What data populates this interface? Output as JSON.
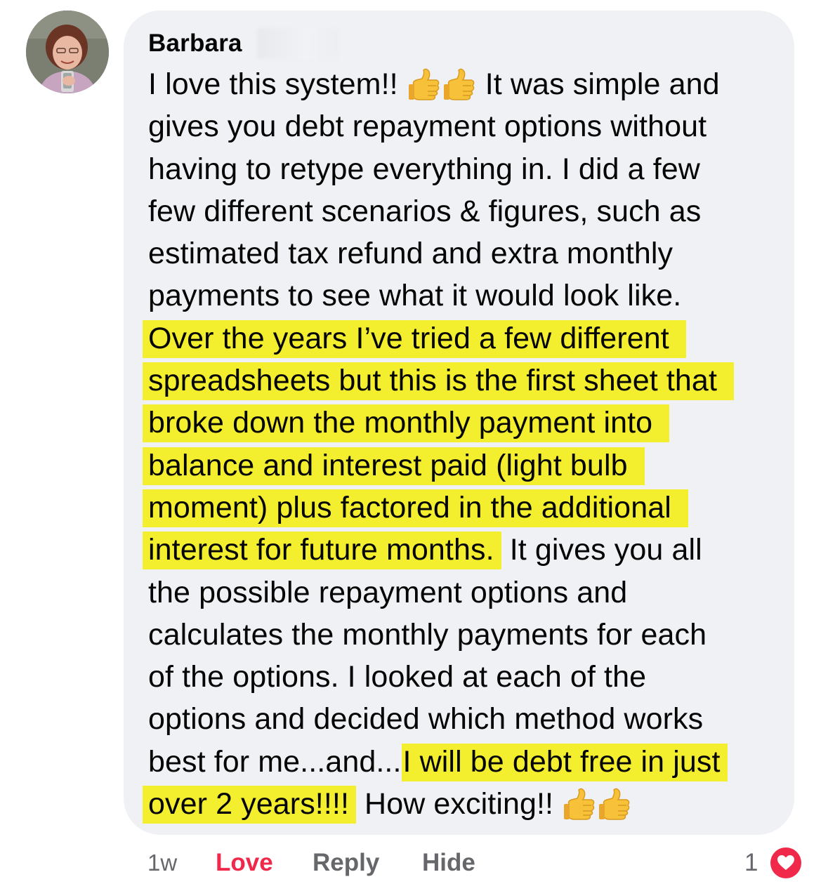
{
  "comment": {
    "author_name": "Barbara",
    "lines": [
      [
        "I love this system!! ",
        "",
        " It was simple and"
      ],
      [
        "gives you debt repayment options without"
      ],
      [
        "having to retype everything in. I did a few"
      ],
      [
        "few different scenarios & figures, such as"
      ],
      [
        "estimated tax refund and extra monthly"
      ],
      [
        "payments to see what it would look like."
      ],
      [
        "Over the years I’ve tried a few different"
      ],
      [
        "spreadsheets but this is the first sheet that"
      ],
      [
        "broke down the monthly payment into"
      ],
      [
        "balance and interest paid (light bulb"
      ],
      [
        "moment) plus factored in the additional"
      ],
      [
        "interest for future months.",
        " It gives you all"
      ],
      [
        "the possible repayment options and"
      ],
      [
        "calculates the monthly payments for each"
      ],
      [
        "of the options. I looked at each of the"
      ],
      [
        "options and decided which method works"
      ],
      [
        "best for me...and...",
        "I will be debt free in just"
      ],
      [
        "over 2 years!!!!",
        " How exciting!! "
      ]
    ],
    "emoji": "thumbs-up-icon",
    "highlight_color": "#f3ee2e"
  },
  "actions": {
    "time": "1w",
    "love": "Love",
    "reply": "Reply",
    "hide": "Hide",
    "love_color": "#f0284a"
  },
  "reactions": {
    "count": "1",
    "type": "heart-icon"
  }
}
